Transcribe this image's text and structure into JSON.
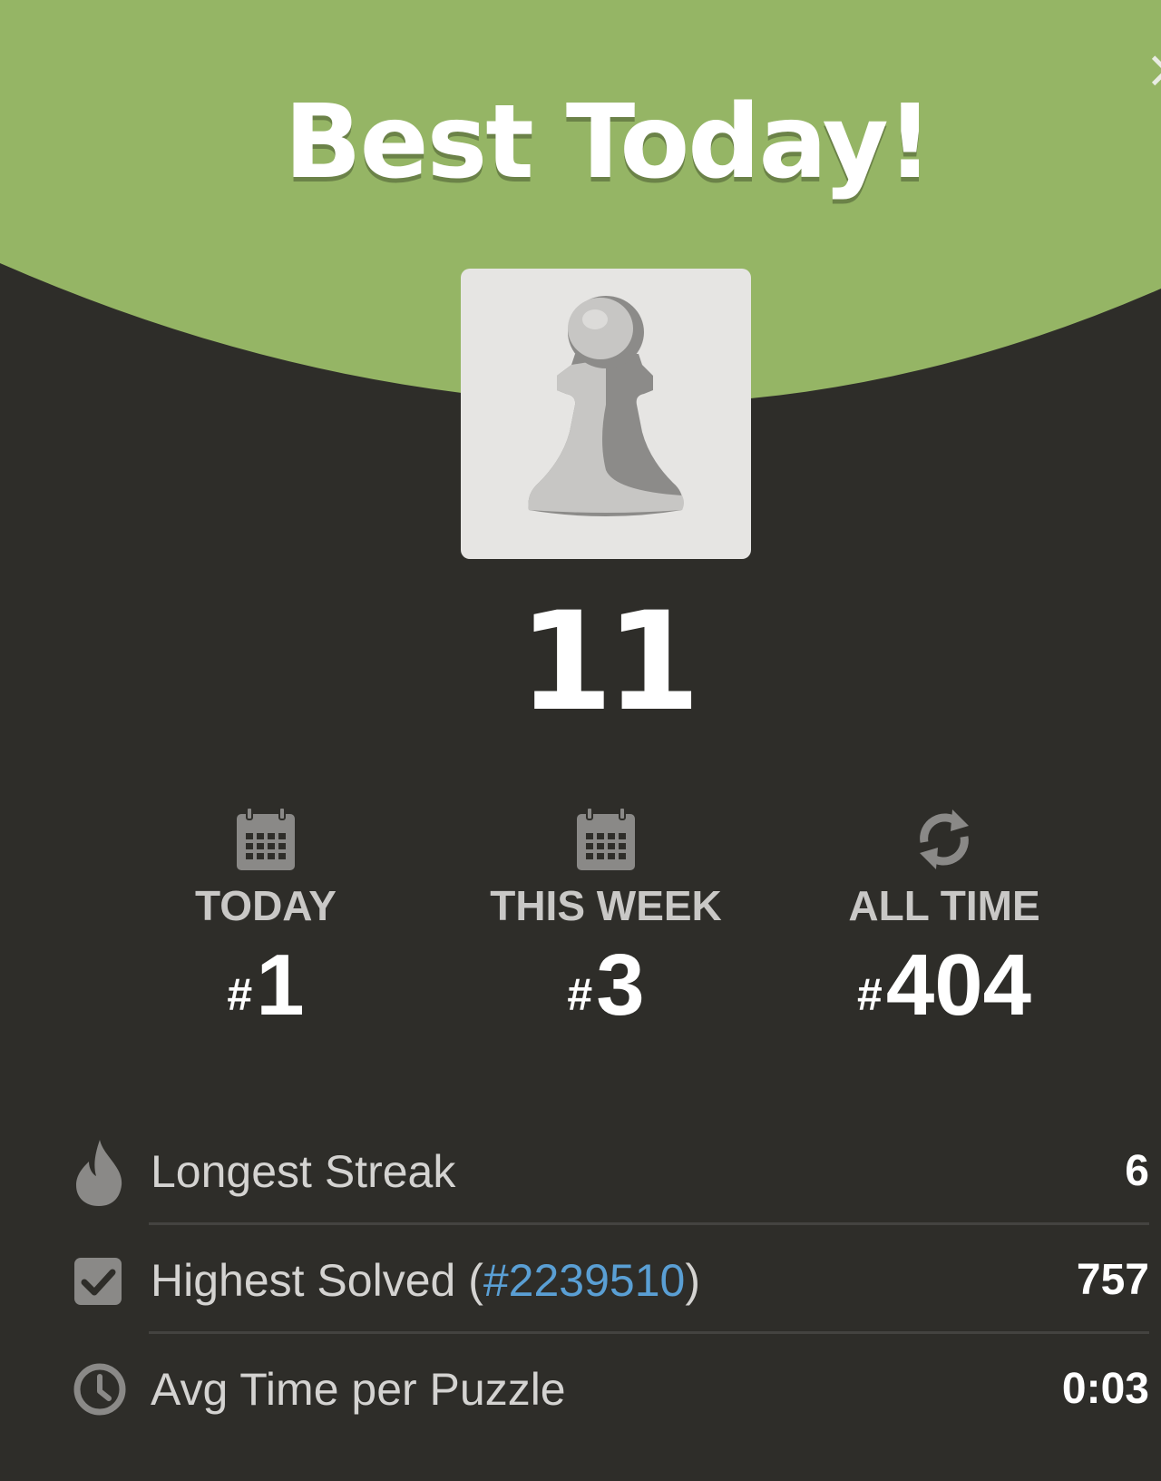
{
  "colors": {
    "header_green": "#95b565",
    "background": "#2e2d29",
    "link_blue": "#5a9fd4"
  },
  "close_glyph": "×",
  "title": "Best Today!",
  "piece_icon": "pawn-icon",
  "score": "11",
  "ranks": [
    {
      "icon": "calendar-icon",
      "label": "TODAY",
      "hash": "#",
      "value": "1"
    },
    {
      "icon": "calendar-icon",
      "label": "THIS WEEK",
      "hash": "#",
      "value": "3"
    },
    {
      "icon": "refresh-icon",
      "label": "ALL TIME",
      "hash": "#",
      "value": "404"
    }
  ],
  "stats": [
    {
      "icon": "flame-icon",
      "label": "Longest Streak",
      "value": "6"
    },
    {
      "icon": "checkbox-icon",
      "label": "Highest Solved",
      "paren_open": " (",
      "link": "#2239510",
      "paren_close": ")",
      "value": "757"
    },
    {
      "icon": "clock-icon",
      "label": "Avg Time per Puzzle",
      "value": "0:03"
    }
  ]
}
